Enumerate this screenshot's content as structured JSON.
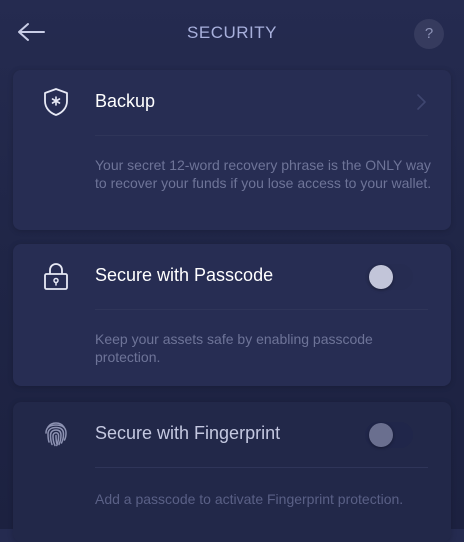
{
  "header": {
    "title": "SECURITY",
    "back_icon": "arrow-left-icon",
    "help_label": "?"
  },
  "backup": {
    "label": "Backup",
    "icon": "shield-asterisk-icon",
    "chevron_icon": "chevron-right-icon",
    "description": "Your secret 12-word recovery phrase is the ONLY way to recover your funds if you lose access to your wallet."
  },
  "passcode": {
    "label": "Secure with Passcode",
    "icon": "lock-icon",
    "enabled": false,
    "description": "Keep your assets safe by enabling passcode protection."
  },
  "fingerprint": {
    "label": "Secure with Fingerprint",
    "icon": "fingerprint-icon",
    "enabled": false,
    "disabled": true,
    "description": "Add a passcode to activate Fingerprint protection."
  }
}
